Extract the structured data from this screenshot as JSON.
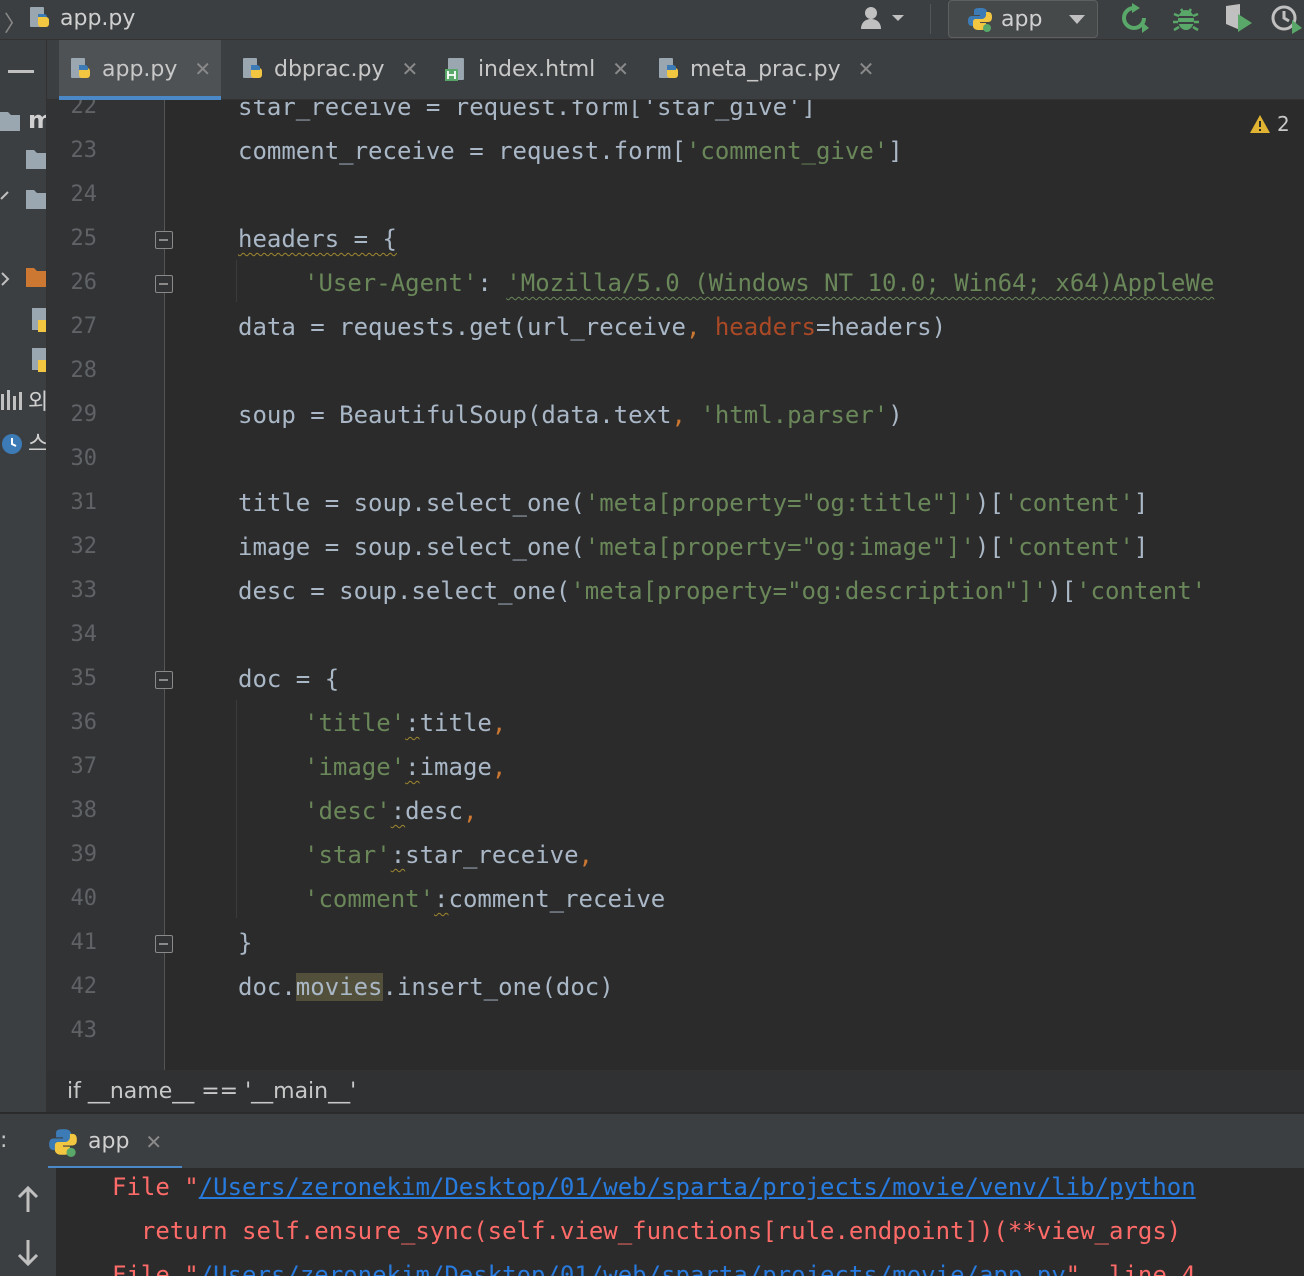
{
  "toolbar": {
    "file_name": "app.py",
    "run_config": "app"
  },
  "tabs": [
    {
      "label": "app.py",
      "icon": "python-file-icon",
      "active": true
    },
    {
      "label": "dbprac.py",
      "icon": "python-file-icon",
      "active": false
    },
    {
      "label": "index.html",
      "icon": "html-file-icon",
      "active": false
    },
    {
      "label": "meta_prac.py",
      "icon": "python-file-icon",
      "active": false
    }
  ],
  "project_strip": {
    "labels": [
      "m",
      "외",
      "스"
    ]
  },
  "editor": {
    "warning_count": "2",
    "line_numbers": [
      "22",
      "23",
      "24",
      "25",
      "26",
      "27",
      "28",
      "29",
      "30",
      "31",
      "32",
      "33",
      "34",
      "35",
      "36",
      "37",
      "38",
      "39",
      "40",
      "41",
      "42",
      "43"
    ],
    "lines": {
      "l22": "star_receive = request.form['star_give']",
      "l23a": "comment_receive = request.form[",
      "l23b": "'comment_give'",
      "l23c": "]",
      "l25": "headers = {",
      "l26a": "'User-Agent'",
      "l26b": ": ",
      "l26c": "'Mozilla/5.0 (Windows NT 10.0; Win64; x64)AppleWe",
      "l27a": "data = requests.get(url_receive",
      "l27b": ", ",
      "l27c": "headers",
      "l27d": "=headers)",
      "l29a": "soup = BeautifulSoup(data.text",
      "l29b": ", ",
      "l29c": "'html.parser'",
      "l29d": ")",
      "l31a": "title = soup.select_one(",
      "l31b": "'meta[property=\"og:title\"]'",
      "l31c": ")[",
      "l31d": "'content'",
      "l31e": "]",
      "l32a": "image = soup.select_one(",
      "l32b": "'meta[property=\"og:image\"]'",
      "l32c": ")[",
      "l32d": "'content'",
      "l32e": "]",
      "l33a": "desc = soup.select_one(",
      "l33b": "'meta[property=\"og:description\"]'",
      "l33c": ")[",
      "l33d": "'content'",
      "l35": "doc = {",
      "l36a": "'title'",
      "l36b": ":",
      "l36c": "title",
      "l36d": ",",
      "l37a": "'image'",
      "l37b": ":",
      "l37c": "image",
      "l37d": ",",
      "l38a": "'desc'",
      "l38b": ":",
      "l38c": "desc",
      "l38d": ",",
      "l39a": "'star'",
      "l39b": ":",
      "l39c": "star_receive",
      "l39d": ",",
      "l40a": "'comment'",
      "l40b": ":",
      "l40c": "comment_receive",
      "l41": "}",
      "l42a": "doc.",
      "l42b": "movies",
      "l42c": ".insert_one(doc)"
    }
  },
  "breadcrumb": "if __name__ == '__main__'",
  "run_panel": {
    "colon": ":",
    "tab_label": "app",
    "console": {
      "line1_prefix": "File \"",
      "line1_link": "/Users/zeronekim/Desktop/01/web/sparta/projects/movie/venv/lib/python",
      "line2": "  return self.ensure_sync(self.view_functions[rule.endpoint])(**view_args)",
      "line3_prefix": "File \"",
      "line3_link": "/Users/zeronekim/Desktop/01/web/sparta/projects/movie/app.py",
      "line3_suffix": "\", line 4"
    }
  },
  "colors": {
    "accent": "#4a88c7",
    "string": "#6a8759",
    "keyword": "#cc7832",
    "error": "#ff6b68",
    "link": "#287bde"
  }
}
